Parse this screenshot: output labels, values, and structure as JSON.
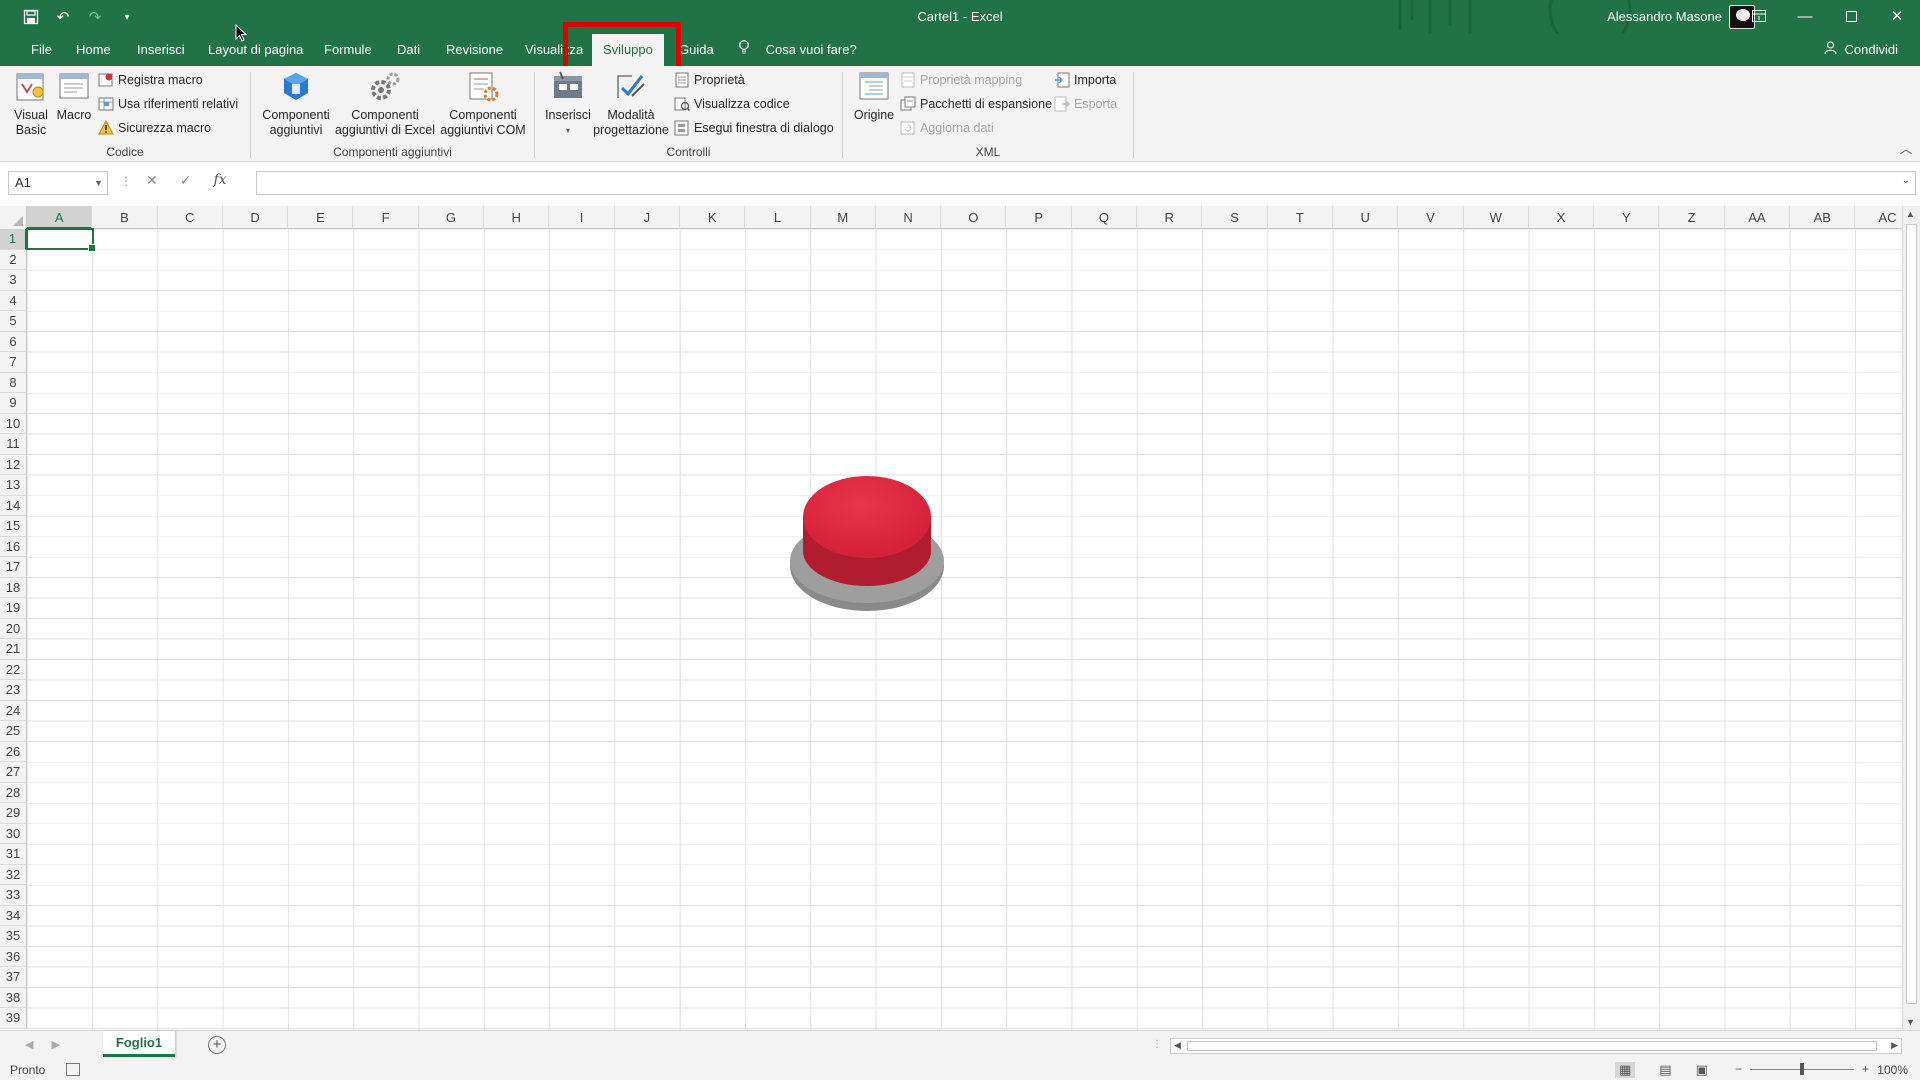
{
  "titlebar": {
    "doc_title": "Cartel1  -  Excel",
    "user_name": "Alessandro Masone",
    "window_buttons": [
      "ribbon-display-icon",
      "minimize-icon",
      "maximize-icon",
      "close-icon"
    ]
  },
  "tabs": [
    {
      "label": "File"
    },
    {
      "label": "Home"
    },
    {
      "label": "Inserisci"
    },
    {
      "label": "Layout di pagina"
    },
    {
      "label": "Formule"
    },
    {
      "label": "Dati"
    },
    {
      "label": "Revisione"
    },
    {
      "label": "Visualizza"
    },
    {
      "label": "Sviluppo",
      "active": true
    },
    {
      "label": "Guida"
    }
  ],
  "tell_me": "Cosa vuoi fare?",
  "share": "Condividi",
  "ribbon": {
    "codice": {
      "label": "Codice",
      "visual_basic_1": "Visual",
      "visual_basic_2": "Basic",
      "macro": "Macro",
      "registra_macro": "Registra macro",
      "usa_riferimenti": "Usa riferimenti relativi",
      "sicurezza_macro": "Sicurezza macro"
    },
    "componenti": {
      "label": "Componenti aggiuntivi",
      "comp_1a": "Componenti",
      "comp_1b": "aggiuntivi",
      "comp_2a": "Componenti",
      "comp_2b": "aggiuntivi di Excel",
      "comp_3a": "Componenti",
      "comp_3b": "aggiuntivi COM"
    },
    "controlli": {
      "label": "Controlli",
      "inserisci": "Inserisci",
      "modalita_1": "Modalità",
      "modalita_2": "progettazione",
      "proprieta": "Proprietà",
      "visualizza_codice": "Visualizza codice",
      "esegui_finestra": "Esegui finestra di dialogo"
    },
    "xml": {
      "label": "XML",
      "origine": "Origine",
      "proprieta_mapping": "Proprietà mapping",
      "pacchetti": "Pacchetti di espansione",
      "aggiorna_dati": "Aggiorna dati",
      "importa": "Importa",
      "esporta": "Esporta"
    }
  },
  "formula_bar": {
    "name_box": "A1",
    "formula": ""
  },
  "columns": [
    "A",
    "B",
    "C",
    "D",
    "E",
    "F",
    "G",
    "H",
    "I",
    "J",
    "K",
    "L",
    "M",
    "N",
    "O",
    "P",
    "Q",
    "R",
    "S",
    "T",
    "U",
    "V",
    "W",
    "X",
    "Y",
    "Z",
    "AA",
    "AB",
    "AC"
  ],
  "rows": [
    "1",
    "2",
    "3",
    "4",
    "5",
    "6",
    "7",
    "8",
    "9",
    "10",
    "11",
    "12",
    "13",
    "14",
    "15",
    "16",
    "17",
    "18",
    "19",
    "20",
    "21",
    "22",
    "23",
    "24",
    "25",
    "26",
    "27",
    "28",
    "29",
    "30",
    "31",
    "32",
    "33",
    "34",
    "35",
    "36",
    "37",
    "38",
    "39"
  ],
  "sheet": {
    "tabs": [
      "Foglio1"
    ],
    "add_icon": "plus-icon"
  },
  "statusbar": {
    "status": "Pronto",
    "zoom": "100%"
  }
}
